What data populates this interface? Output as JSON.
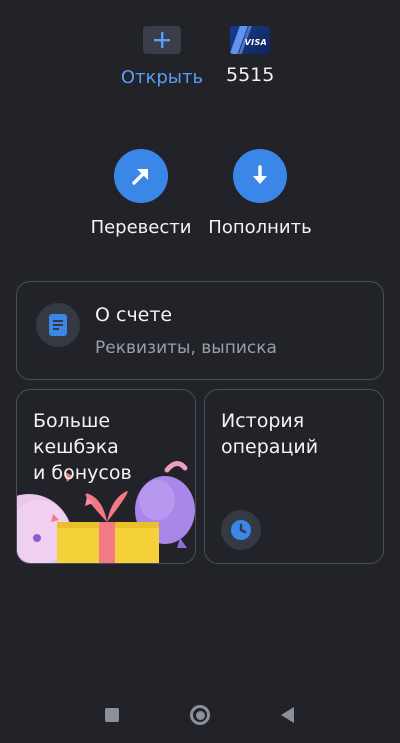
{
  "top": {
    "open": {
      "label": "Открыть",
      "icon": "plus-icon"
    },
    "card": {
      "brand": "VISA",
      "number": "5515"
    }
  },
  "actions": {
    "transfer": {
      "label": "Перевести",
      "icon": "arrow-up-right-icon"
    },
    "topup": {
      "label": "Пополнить",
      "icon": "arrow-down-icon"
    }
  },
  "account_info": {
    "title": "О счете",
    "subtitle": "Реквизиты, выписка",
    "icon": "document-icon"
  },
  "tiles": {
    "cashback": {
      "line1": "Больше",
      "line2": "кешбэка",
      "line3": "и бонусов"
    },
    "history": {
      "line1": "История",
      "line2": "операций",
      "icon": "clock-icon"
    }
  },
  "navbar": {
    "items": [
      "recents-button",
      "home-button",
      "back-button"
    ]
  },
  "colors": {
    "background": "#212329",
    "accent": "#3b87e8",
    "link": "#5a9cf6",
    "border": "#4a4e58",
    "muted_text": "#9a9ea8"
  }
}
